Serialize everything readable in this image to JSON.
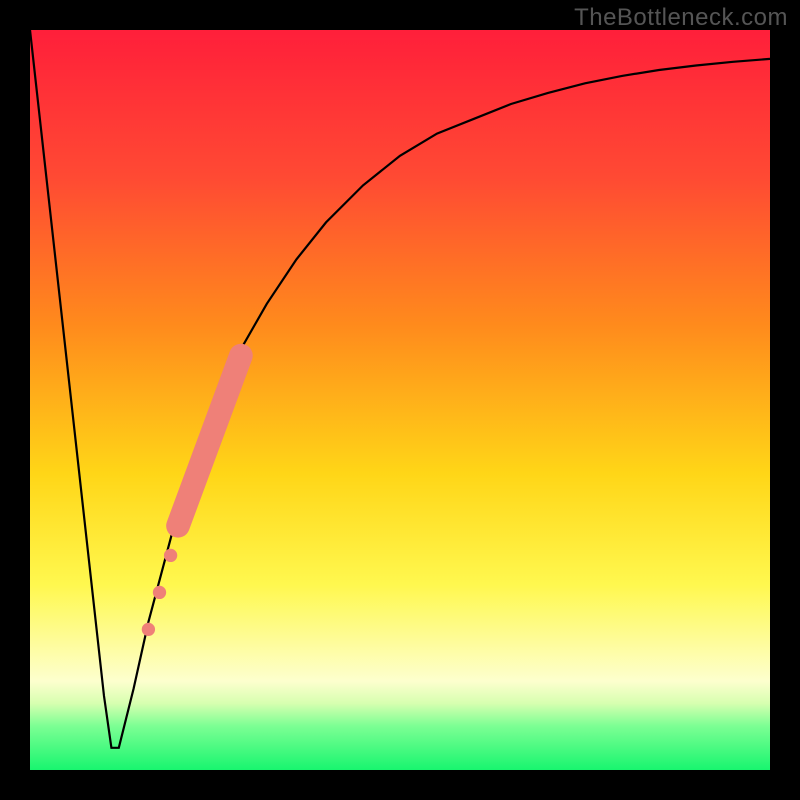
{
  "watermark": "TheBottleneck.com",
  "chart_data": {
    "type": "line",
    "title": "",
    "xlabel": "",
    "ylabel": "",
    "xlim": [
      0,
      100
    ],
    "ylim": [
      0,
      100
    ],
    "series": [
      {
        "name": "bottleneck-curve",
        "x": [
          0,
          2,
          4,
          6,
          8,
          10,
          11,
          12,
          14,
          16,
          20,
          24,
          28,
          32,
          36,
          40,
          45,
          50,
          55,
          60,
          65,
          70,
          75,
          80,
          85,
          90,
          95,
          100
        ],
        "y": [
          100,
          82,
          64,
          46,
          28,
          10,
          3,
          3,
          11,
          20,
          35,
          47,
          56,
          63,
          69,
          74,
          79,
          83,
          86,
          88,
          90,
          91.5,
          92.8,
          93.8,
          94.6,
          95.2,
          95.7,
          96.1
        ]
      }
    ],
    "highlight_range": {
      "name": "gpu-range-marker",
      "color": "#ef8078",
      "points": [
        {
          "x": 16,
          "y": 19,
          "r": 0.9
        },
        {
          "x": 17.5,
          "y": 24,
          "r": 0.9
        },
        {
          "x": 19,
          "y": 29,
          "r": 0.9
        }
      ],
      "stroke_segment": {
        "x1": 20,
        "y1": 33,
        "x2": 28.5,
        "y2": 56,
        "radius": 1.6
      }
    },
    "background_gradient": {
      "stops": [
        {
          "pos": 0.0,
          "color": "#ff1f3a"
        },
        {
          "pos": 0.2,
          "color": "#ff4a33"
        },
        {
          "pos": 0.4,
          "color": "#ff8b1c"
        },
        {
          "pos": 0.6,
          "color": "#ffd617"
        },
        {
          "pos": 0.75,
          "color": "#fff84f"
        },
        {
          "pos": 0.88,
          "color": "#fdffce"
        },
        {
          "pos": 0.91,
          "color": "#d7ffb0"
        },
        {
          "pos": 0.94,
          "color": "#7dff94"
        },
        {
          "pos": 1.0,
          "color": "#18f56f"
        }
      ]
    }
  }
}
